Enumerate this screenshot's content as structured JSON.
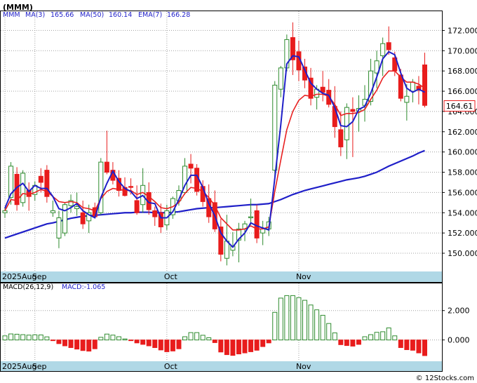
{
  "ticker": "(MMM)",
  "legend": {
    "symbol": "MMM",
    "ma3_label": "MA(3)",
    "ma3_value": "165.66",
    "ma50_label": "MA(50)",
    "ma50_value": "160.14",
    "ema7_label": "EMA(7)",
    "ema7_value": "166.28"
  },
  "macd_legend": {
    "params": "MACD(26,12,9)",
    "value": "MACD:-1.065"
  },
  "last_price_label": "164.61",
  "credit": "© 12Stocks.com",
  "colors": {
    "up": "#2e8b2e",
    "down": "#e81c1c",
    "ma_blue": "#1f1fc8",
    "ema_red": "#e82020",
    "axis_band": "#b0d8e6",
    "grid": "#a0a0a0"
  },
  "chart_data": [
    {
      "type": "candlestick",
      "title": "",
      "y_ticks": [
        150,
        152,
        154,
        156,
        158,
        160,
        162,
        164,
        166,
        168,
        170,
        172
      ],
      "y_tick_labels": [
        "150.000",
        "152.000",
        "154.000",
        "156.000",
        "158.000",
        "160.000",
        "162.000",
        "164.000",
        "166.000",
        "168.000",
        "170.000",
        "172.000"
      ],
      "ylim": [
        148.2,
        173.9
      ],
      "x_labels": [
        {
          "index": 0,
          "text": "2025Aug"
        },
        {
          "index": 5,
          "text": "Sep"
        },
        {
          "index": 27,
          "text": "Oct"
        },
        {
          "index": 49,
          "text": "Nov"
        }
      ],
      "candles": [
        [
          154.0,
          154.5,
          153.5,
          154.2
        ],
        [
          155.5,
          159.0,
          154.8,
          158.6
        ],
        [
          157.8,
          158.5,
          154.2,
          154.8
        ],
        [
          155.0,
          158.2,
          154.6,
          157.9
        ],
        [
          156.2,
          157.0,
          154.2,
          155.6
        ],
        [
          155.8,
          157.1,
          155.2,
          156.7
        ],
        [
          157.6,
          158.4,
          156.0,
          157.0
        ],
        [
          158.2,
          158.7,
          155.0,
          155.6
        ],
        [
          154.0,
          155.2,
          153.6,
          154.2
        ],
        [
          151.5,
          154.2,
          150.5,
          153.5
        ],
        [
          152.0,
          155.0,
          151.7,
          154.8
        ],
        [
          154.7,
          155.8,
          154.0,
          155.2
        ],
        [
          154.4,
          156.0,
          153.7,
          154.6
        ],
        [
          154.0,
          155.2,
          152.4,
          152.9
        ],
        [
          153.2,
          154.8,
          152.0,
          154.0
        ],
        [
          154.5,
          155.0,
          153.5,
          153.6
        ],
        [
          154.0,
          159.4,
          153.8,
          159.0
        ],
        [
          159.0,
          162.1,
          157.8,
          158.0
        ],
        [
          158.2,
          159.0,
          156.8,
          157.2
        ],
        [
          157.4,
          158.2,
          155.6,
          156.2
        ],
        [
          156.5,
          157.5,
          155.6,
          155.7
        ],
        [
          156.6,
          157.4,
          155.8,
          156.5
        ],
        [
          155.2,
          156.7,
          153.8,
          154.0
        ],
        [
          154.8,
          158.4,
          154.0,
          156.7
        ],
        [
          156.0,
          157.0,
          153.8,
          154.3
        ],
        [
          154.2,
          154.6,
          152.7,
          153.6
        ],
        [
          154.0,
          154.9,
          152.0,
          152.6
        ],
        [
          152.8,
          154.8,
          152.3,
          154.2
        ],
        [
          153.8,
          155.6,
          153.4,
          155.4
        ],
        [
          155.2,
          156.7,
          154.7,
          156.2
        ],
        [
          156.0,
          159.4,
          155.8,
          158.6
        ],
        [
          158.8,
          159.8,
          156.9,
          158.4
        ],
        [
          158.4,
          158.8,
          155.7,
          156.1
        ],
        [
          156.6,
          157.2,
          154.6,
          155.1
        ],
        [
          155.4,
          156.8,
          153.0,
          153.6
        ],
        [
          155.0,
          156.2,
          152.1,
          152.4
        ],
        [
          152.6,
          153.4,
          149.2,
          149.9
        ],
        [
          149.5,
          153.8,
          148.8,
          151.2
        ],
        [
          150.3,
          152.1,
          149.7,
          150.7
        ],
        [
          151.3,
          153.0,
          149.1,
          152.4
        ],
        [
          152.4,
          153.2,
          151.2,
          152.9
        ],
        [
          153.5,
          155.4,
          152.8,
          153.6
        ],
        [
          154.2,
          154.8,
          151.0,
          151.5
        ],
        [
          152.0,
          153.2,
          150.8,
          152.4
        ],
        [
          152.4,
          153.6,
          151.7,
          153.1
        ],
        [
          158.2,
          167.0,
          157.6,
          166.6
        ],
        [
          166.2,
          168.5,
          165.4,
          168.3
        ],
        [
          168.3,
          171.6,
          168.0,
          171.1
        ],
        [
          171.3,
          172.8,
          167.6,
          169.1
        ],
        [
          169.9,
          171.0,
          167.0,
          168.1
        ],
        [
          168.4,
          169.2,
          166.3,
          167.1
        ],
        [
          167.3,
          168.3,
          164.6,
          165.3
        ],
        [
          165.4,
          166.6,
          164.2,
          166.2
        ],
        [
          166.4,
          168.0,
          165.0,
          165.9
        ],
        [
          166.1,
          167.2,
          164.4,
          164.7
        ],
        [
          164.5,
          166.5,
          161.4,
          162.5
        ],
        [
          162.2,
          164.0,
          159.6,
          160.5
        ],
        [
          161.2,
          164.8,
          159.3,
          164.4
        ],
        [
          164.2,
          165.4,
          159.5,
          164.0
        ],
        [
          164.0,
          165.6,
          162.0,
          164.3
        ],
        [
          164.6,
          166.6,
          163.0,
          165.2
        ],
        [
          165.0,
          169.2,
          164.6,
          168.0
        ],
        [
          167.8,
          170.0,
          166.3,
          169.0
        ],
        [
          169.5,
          171.3,
          167.5,
          170.7
        ],
        [
          170.8,
          172.4,
          169.6,
          170.1
        ],
        [
          169.3,
          169.9,
          167.5,
          168.0
        ],
        [
          167.6,
          168.2,
          165.0,
          165.3
        ],
        [
          164.9,
          166.7,
          163.1,
          165.5
        ],
        [
          166.0,
          167.2,
          164.9,
          166.9
        ],
        [
          166.5,
          167.5,
          164.7,
          166.1
        ],
        [
          168.6,
          169.8,
          164.4,
          164.6
        ]
      ],
      "ma3": [
        154.45,
        155.87,
        156.5,
        156.9,
        156.1,
        156.7,
        156.4,
        156.4,
        155.6,
        154.4,
        154.2,
        154.5,
        154.9,
        154.2,
        153.8,
        153.5,
        155.5,
        156.9,
        158.1,
        157.1,
        156.4,
        156.1,
        155.4,
        155.7,
        155.0,
        154.9,
        153.5,
        153.5,
        154.1,
        155.3,
        156.7,
        157.7,
        157.7,
        156.5,
        154.9,
        153.7,
        152.0,
        151.2,
        150.6,
        151.4,
        152.0,
        153.0,
        152.7,
        152.5,
        152.3,
        157.4,
        162.7,
        168.7,
        169.5,
        169.4,
        168.1,
        166.8,
        166.2,
        165.8,
        165.6,
        164.4,
        162.6,
        162.5,
        163.0,
        164.2,
        164.5,
        165.8,
        167.4,
        169.2,
        169.9,
        169.6,
        167.8,
        166.3,
        165.9,
        166.2,
        165.9
      ],
      "ema7": [
        154.2,
        155.3,
        155.2,
        155.9,
        155.8,
        156.0,
        156.3,
        156.1,
        155.6,
        155.1,
        155.0,
        155.1,
        155.0,
        154.5,
        154.4,
        154.2,
        155.4,
        156.1,
        156.4,
        156.3,
        156.2,
        156.2,
        155.8,
        156.0,
        155.6,
        155.1,
        154.5,
        154.4,
        154.6,
        155.0,
        155.9,
        156.5,
        156.4,
        156.1,
        155.5,
        154.7,
        153.5,
        152.9,
        152.3,
        152.3,
        152.4,
        152.7,
        152.4,
        152.4,
        152.6,
        156.1,
        159.2,
        162.2,
        164.0,
        165.1,
        165.6,
        165.5,
        165.7,
        165.7,
        165.5,
        164.7,
        163.6,
        163.8,
        163.8,
        163.9,
        164.2,
        165.2,
        166.1,
        167.3,
        168.0,
        168.0,
        167.4,
        166.9,
        166.9,
        166.7,
        166.3
      ],
      "ma50": [
        151.5,
        151.7,
        151.9,
        152.1,
        152.3,
        152.5,
        152.7,
        152.9,
        153.0,
        153.15,
        153.3,
        153.45,
        153.55,
        153.65,
        153.7,
        153.75,
        153.8,
        153.85,
        153.9,
        153.95,
        154.0,
        154.0,
        154.05,
        154.05,
        154.05,
        154.0,
        154.0,
        154.0,
        154.05,
        154.1,
        154.2,
        154.3,
        154.4,
        154.45,
        154.5,
        154.5,
        154.55,
        154.6,
        154.65,
        154.7,
        154.75,
        154.8,
        154.8,
        154.85,
        154.9,
        155.1,
        155.3,
        155.55,
        155.8,
        156.0,
        156.2,
        156.35,
        156.5,
        156.65,
        156.8,
        156.95,
        157.1,
        157.25,
        157.35,
        157.45,
        157.6,
        157.8,
        158.0,
        158.3,
        158.6,
        158.85,
        159.1,
        159.35,
        159.6,
        159.9,
        160.14
      ],
      "macd_histogram": [
        0.28,
        0.41,
        0.39,
        0.36,
        0.33,
        0.35,
        0.34,
        0.21,
        -0.03,
        -0.25,
        -0.4,
        -0.52,
        -0.62,
        -0.72,
        -0.76,
        -0.6,
        0.18,
        0.4,
        0.33,
        0.22,
        0.07,
        -0.03,
        -0.2,
        -0.3,
        -0.4,
        -0.52,
        -0.68,
        -0.8,
        -0.75,
        -0.6,
        0.22,
        0.5,
        0.5,
        0.32,
        0.15,
        -0.18,
        -0.82,
        -1.0,
        -1.05,
        -0.95,
        -0.88,
        -0.8,
        -0.7,
        -0.45,
        -0.2,
        1.88,
        2.85,
        3.02,
        3.02,
        2.88,
        2.7,
        2.38,
        2.05,
        1.68,
        1.12,
        0.48,
        -0.32,
        -0.38,
        -0.42,
        -0.3,
        0.22,
        0.36,
        0.52,
        0.56,
        0.82,
        0.28,
        -0.52,
        -0.66,
        -0.7,
        -0.88,
        -1.065
      ],
      "macd_y_ticks": [
        0,
        2
      ],
      "macd_y_tick_labels": [
        "0.000",
        "2.000"
      ],
      "macd_ylim": [
        -1.45,
        3.85
      ]
    }
  ]
}
